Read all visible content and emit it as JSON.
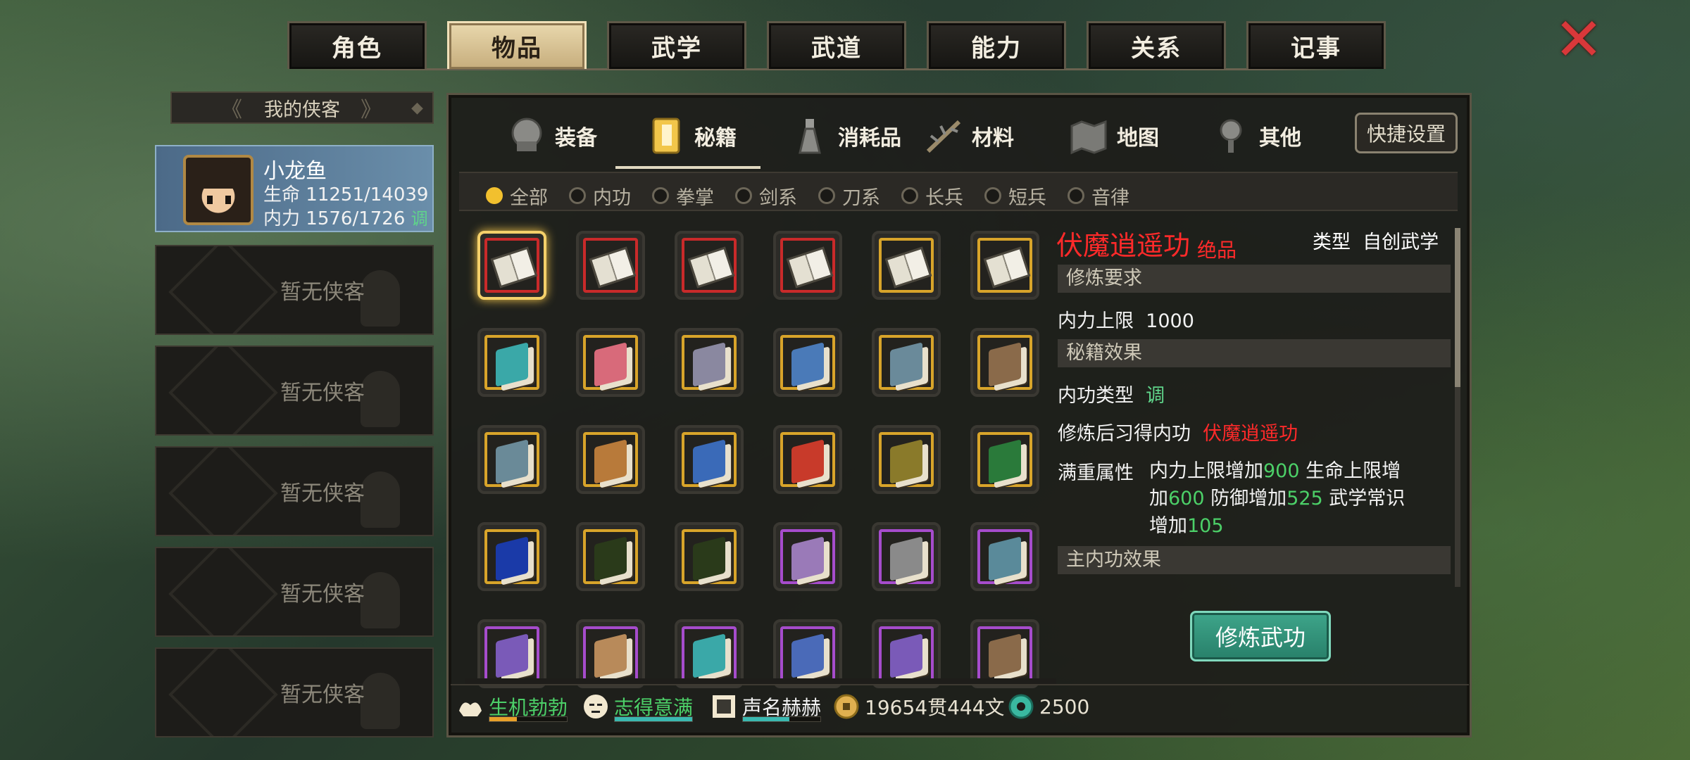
{
  "top_tabs": [
    {
      "label": "角色",
      "active": false
    },
    {
      "label": "物品",
      "active": true
    },
    {
      "label": "武学",
      "active": false
    },
    {
      "label": "武道",
      "active": false
    },
    {
      "label": "能力",
      "active": false
    },
    {
      "label": "关系",
      "active": false
    },
    {
      "label": "记事",
      "active": false
    }
  ],
  "left_panel": {
    "header": "我的侠客",
    "active_hero": {
      "name": "小龙鱼",
      "hp_label": "生命",
      "hp_value": "11251/14039",
      "mp_label": "内力",
      "mp_value": "1576/1726",
      "mp_tag": "调"
    },
    "empty_slot_label": "暂无侠客",
    "empty_slots": [
      "暂无侠客",
      "暂无侠客",
      "暂无侠客",
      "暂无侠客",
      "暂无侠客"
    ]
  },
  "category_tabs": [
    {
      "label": "装备",
      "icon": "armor-icon"
    },
    {
      "label": "秘籍",
      "icon": "scroll-book-icon",
      "active": true
    },
    {
      "label": "消耗品",
      "icon": "potion-icon"
    },
    {
      "label": "材料",
      "icon": "herb-icon"
    },
    {
      "label": "地图",
      "icon": "map-icon"
    },
    {
      "label": "其他",
      "icon": "lamp-icon"
    }
  ],
  "quick_settings_label": "快捷设置",
  "filters": [
    {
      "label": "全部",
      "selected": true
    },
    {
      "label": "内功",
      "selected": false
    },
    {
      "label": "拳掌",
      "selected": false
    },
    {
      "label": "剑系",
      "selected": false
    },
    {
      "label": "刀系",
      "selected": false
    },
    {
      "label": "长兵",
      "selected": false
    },
    {
      "label": "短兵",
      "selected": false
    },
    {
      "label": "音律",
      "selected": false
    }
  ],
  "grid_items": [
    {
      "rarity": "red",
      "color": "#e8e4d8",
      "selected": true,
      "kind": "open"
    },
    {
      "rarity": "red",
      "color": "#d8d4c4",
      "kind": "open"
    },
    {
      "rarity": "red",
      "color": "#d8d4c4",
      "kind": "open"
    },
    {
      "rarity": "red",
      "color": "#d8d4c4",
      "kind": "open"
    },
    {
      "rarity": "gold",
      "color": "#d8d4c4",
      "kind": "open"
    },
    {
      "rarity": "gold",
      "color": "#d8d4c4",
      "kind": "open"
    },
    {
      "rarity": "gold",
      "color": "#3aa8a8"
    },
    {
      "rarity": "gold",
      "color": "#d86a7a"
    },
    {
      "rarity": "gold",
      "color": "#8a88a0"
    },
    {
      "rarity": "gold",
      "color": "#4a7ab8"
    },
    {
      "rarity": "gold",
      "color": "#6a8a9a"
    },
    {
      "rarity": "gold",
      "color": "#8a6a4a"
    },
    {
      "rarity": "gold",
      "color": "#6a8a98"
    },
    {
      "rarity": "gold",
      "color": "#b87a3a"
    },
    {
      "rarity": "gold",
      "color": "#3a6ab8"
    },
    {
      "rarity": "gold",
      "color": "#c83a2a"
    },
    {
      "rarity": "gold",
      "color": "#8a7a2a"
    },
    {
      "rarity": "gold",
      "color": "#2a7a3a"
    },
    {
      "rarity": "gold",
      "color": "#1a3aa8"
    },
    {
      "rarity": "gold",
      "color": "#2a3a1a"
    },
    {
      "rarity": "gold",
      "color": "#2a3a1a"
    },
    {
      "rarity": "purple",
      "color": "#9a7ab8"
    },
    {
      "rarity": "purple",
      "color": "#8a8a8a"
    },
    {
      "rarity": "purple",
      "color": "#5a8a9a"
    },
    {
      "rarity": "purple",
      "color": "#7a5ab8"
    },
    {
      "rarity": "purple",
      "color": "#b88a5a"
    },
    {
      "rarity": "purple",
      "color": "#3aa8a8"
    },
    {
      "rarity": "purple",
      "color": "#4a6ab8"
    },
    {
      "rarity": "purple",
      "color": "#7a5ab8"
    },
    {
      "rarity": "purple",
      "color": "#8a6a4a"
    }
  ],
  "detail": {
    "title": "伏魔逍遥功",
    "grade": "绝品",
    "type_label": "类型",
    "type_value": "自创武学",
    "sec_req": "修炼要求",
    "req_label": "内力上限",
    "req_value": "1000",
    "sec_effect": "秘籍效果",
    "neigong_type_label": "内功类型",
    "neigong_type_value": "调",
    "learn_label": "修炼后习得内功",
    "learn_value": "伏魔逍遥功",
    "full_label": "满重属性",
    "full_p1": "内力上限增加",
    "full_v1": "900",
    "full_p2": "生命上限增",
    "full_p3": "加",
    "full_v2": "600",
    "full_p4": "防御增加",
    "full_v3": "525",
    "full_p5": "武学常识",
    "full_p6": "增加",
    "full_v4": "105",
    "sec_main": "主内功效果",
    "train_button": "修炼武功"
  },
  "status": {
    "s1": "生机勃勃",
    "s1_level": 0.35,
    "s2": "志得意满",
    "s2_level": 1.0,
    "s3": "声名赫赫",
    "s3_level": 0.6,
    "money": "19654贯444文",
    "jade": "2500"
  },
  "colors": {
    "rare_red": "#c92a2a",
    "rare_gold": "#d8a42a",
    "rare_purple": "#a64ccc",
    "accent_green": "#4cd068",
    "title_red": "#ff2a2a"
  }
}
